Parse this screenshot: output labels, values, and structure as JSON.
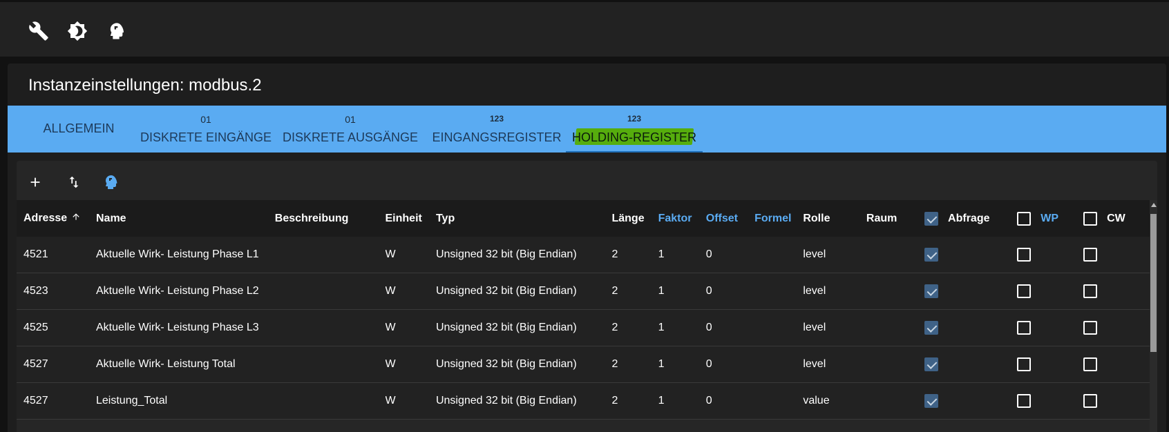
{
  "panel": {
    "title": "Instanzeinstellungen: modbus.2"
  },
  "tabs": [
    {
      "label": "ALLGEMEIN",
      "badge": ""
    },
    {
      "label": "DISKRETE EINGÄNGE",
      "badge": "01"
    },
    {
      "label": "DISKRETE AUSGÄNGE",
      "badge": "01"
    },
    {
      "label": "EINGANGSREGISTER",
      "badge": "123"
    },
    {
      "label": "HOLDING-REGISTER",
      "badge": "123"
    }
  ],
  "table": {
    "columns": [
      "Adresse",
      "Name",
      "Beschreibung",
      "Einheit",
      "Typ",
      "Länge",
      "Faktor",
      "Offset",
      "Formel",
      "Rolle",
      "Raum",
      "Abfrage",
      "WP",
      "CW"
    ],
    "rows": [
      {
        "adresse": "4521",
        "name": "Aktuelle Wirk- Leistung Phase L1",
        "beschreibung": "",
        "einheit": "W",
        "typ": "Unsigned 32 bit (Big Endian)",
        "laenge": "2",
        "faktor": "1",
        "offset": "0",
        "formel": "",
        "rolle": "level",
        "raum": "",
        "abfrage": true,
        "wp": false,
        "cw": false
      },
      {
        "adresse": "4523",
        "name": "Aktuelle Wirk- Leistung Phase L2",
        "beschreibung": "",
        "einheit": "W",
        "typ": "Unsigned 32 bit (Big Endian)",
        "laenge": "2",
        "faktor": "1",
        "offset": "0",
        "formel": "",
        "rolle": "level",
        "raum": "",
        "abfrage": true,
        "wp": false,
        "cw": false
      },
      {
        "adresse": "4525",
        "name": "Aktuelle Wirk- Leistung Phase L3",
        "beschreibung": "",
        "einheit": "W",
        "typ": "Unsigned 32 bit (Big Endian)",
        "laenge": "2",
        "faktor": "1",
        "offset": "0",
        "formel": "",
        "rolle": "level",
        "raum": "",
        "abfrage": true,
        "wp": false,
        "cw": false
      },
      {
        "adresse": "4527",
        "name": "Aktuelle Wirk- Leistung Total",
        "beschreibung": "",
        "einheit": "W",
        "typ": "Unsigned 32 bit (Big Endian)",
        "laenge": "2",
        "faktor": "1",
        "offset": "0",
        "formel": "",
        "rolle": "level",
        "raum": "",
        "abfrage": true,
        "wp": false,
        "cw": false
      },
      {
        "adresse": "4527",
        "name": "Leistung_Total",
        "beschreibung": "",
        "einheit": "W",
        "typ": "Unsigned 32 bit (Big Endian)",
        "laenge": "2",
        "faktor": "1",
        "offset": "0",
        "formel": "",
        "rolle": "value",
        "raum": "",
        "abfrage": true,
        "wp": false,
        "cw": false
      }
    ]
  },
  "icons": {
    "top": [
      "wrench-icon",
      "brightness-icon",
      "expert-head-icon"
    ],
    "toolbar": [
      "add-icon",
      "import-export-icon",
      "expert-head-icon"
    ]
  },
  "colors": {
    "accent": "#5aabf2",
    "highlight": "#56ad0d",
    "checked": "#3f6287"
  }
}
